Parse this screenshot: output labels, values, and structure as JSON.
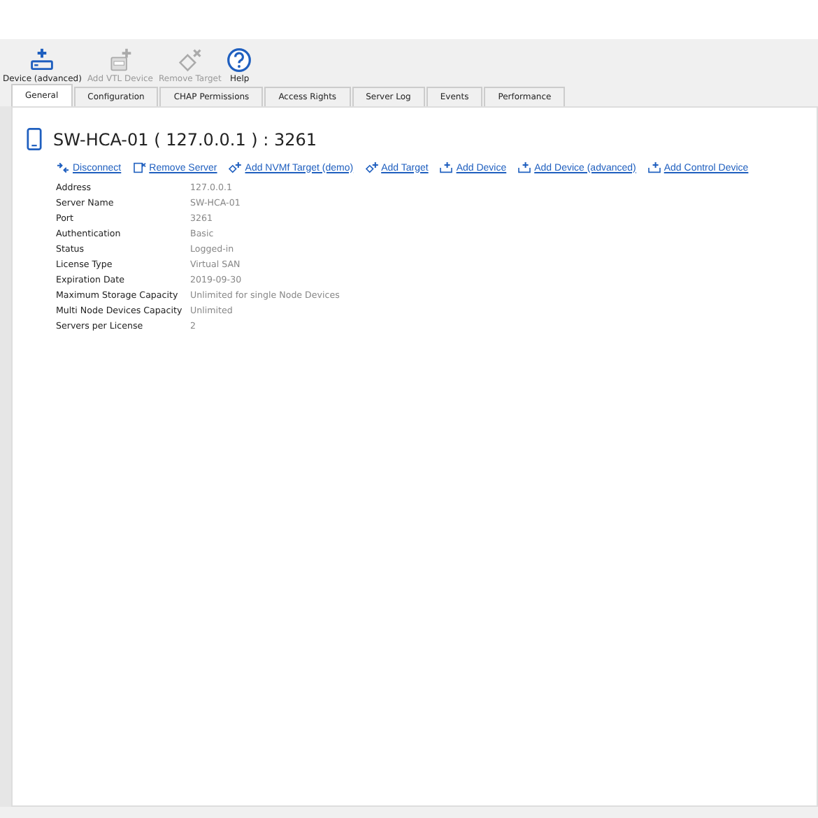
{
  "toolbar": [
    {
      "label": "Device (advanced)",
      "kind": "device",
      "disabled": false
    },
    {
      "label": "Add VTL Device",
      "kind": "vtl",
      "disabled": true
    },
    {
      "label": "Remove Target",
      "kind": "target",
      "disabled": true
    },
    {
      "label": "Help",
      "kind": "help",
      "disabled": false
    }
  ],
  "tabs": [
    {
      "label": "General",
      "selected": true
    },
    {
      "label": "Configuration",
      "selected": false
    },
    {
      "label": "CHAP Permissions",
      "selected": false
    },
    {
      "label": "Access Rights",
      "selected": false
    },
    {
      "label": "Server Log",
      "selected": false
    },
    {
      "label": "Events",
      "selected": false
    },
    {
      "label": "Performance",
      "selected": false
    }
  ],
  "server": {
    "title": "SW-HCA-01 ( 127.0.0.1 ) : 3261"
  },
  "actions": [
    {
      "label": "Disconnect",
      "kind": "disconnect"
    },
    {
      "label": "Remove Server",
      "kind": "remove"
    },
    {
      "label": "Add NVMf Target (demo)",
      "kind": "target"
    },
    {
      "label": "Add Target",
      "kind": "target"
    },
    {
      "label": "Add Device",
      "kind": "device"
    },
    {
      "label": "Add Device (advanced)",
      "kind": "device"
    },
    {
      "label": "Add Control Device",
      "kind": "device"
    }
  ],
  "properties": [
    {
      "name": "Address",
      "value": "127.0.0.1"
    },
    {
      "name": "Server Name",
      "value": "SW-HCA-01"
    },
    {
      "name": "Port",
      "value": "3261"
    },
    {
      "name": "Authentication",
      "value": "Basic"
    },
    {
      "name": "Status",
      "value": "Logged-in"
    },
    {
      "name": "License Type",
      "value": "Virtual SAN"
    },
    {
      "name": "Expiration Date",
      "value": "2019-09-30"
    },
    {
      "name": "Maximum Storage Capacity",
      "value": "Unlimited for single Node Devices"
    },
    {
      "name": "Multi Node Devices Capacity",
      "value": "Unlimited"
    },
    {
      "name": "Servers per License",
      "value": "2"
    }
  ]
}
